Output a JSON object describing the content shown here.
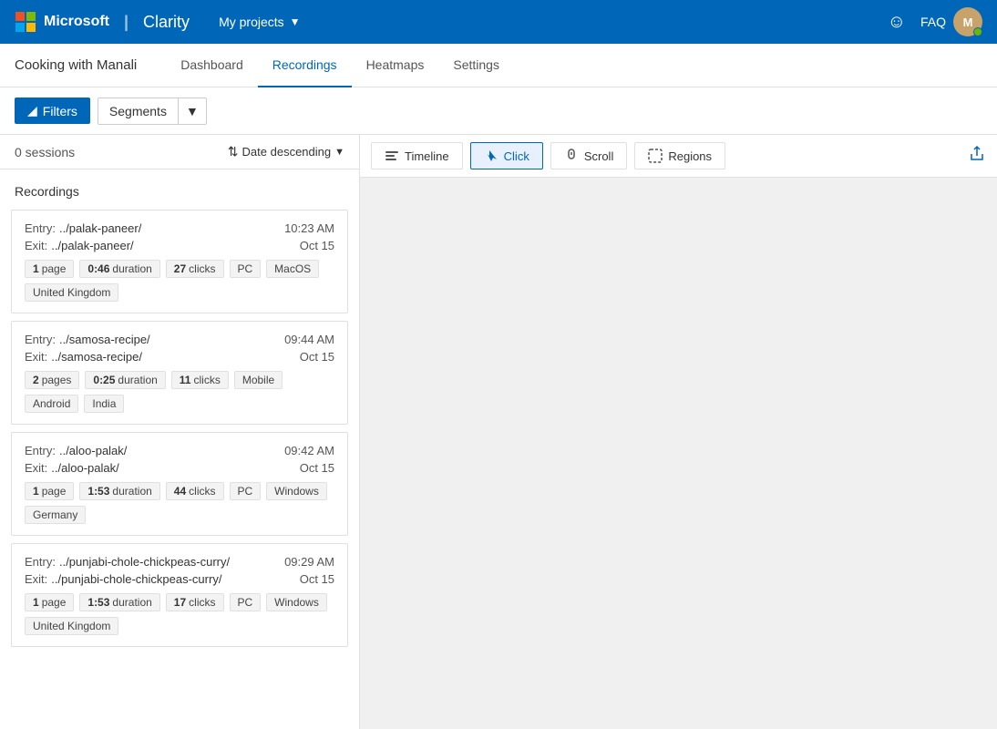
{
  "brand": {
    "ms_label": "Microsoft",
    "divider": "|",
    "clarity_label": "Clarity"
  },
  "topnav": {
    "my_projects": "My projects",
    "faq": "FAQ"
  },
  "subnav": {
    "project_title": "Cooking with Manali",
    "tabs": [
      {
        "label": "Dashboard",
        "active": false
      },
      {
        "label": "Recordings",
        "active": true
      },
      {
        "label": "Heatmaps",
        "active": false
      },
      {
        "label": "Settings",
        "active": false
      }
    ]
  },
  "toolbar": {
    "filter_label": "Filters",
    "segments_label": "Segments"
  },
  "sessions": {
    "count_label": "0 sessions",
    "sort_label": "Date descending"
  },
  "recordings_section": {
    "header": "Recordings",
    "cards": [
      {
        "entry_label": "Entry:",
        "entry_path": "../palak-paneer/",
        "exit_label": "Exit:",
        "exit_path": "../palak-paneer/",
        "time": "10:23 AM",
        "date": "Oct 15",
        "pages_count": "1",
        "pages_label": "page",
        "duration": "0:46",
        "duration_label": "duration",
        "clicks": "27",
        "clicks_label": "clicks",
        "tags": [
          "PC",
          "MacOS",
          "United Kingdom"
        ]
      },
      {
        "entry_label": "Entry:",
        "entry_path": "../samosa-recipe/",
        "exit_label": "Exit:",
        "exit_path": "../samosa-recipe/",
        "time": "09:44 AM",
        "date": "Oct 15",
        "pages_count": "2",
        "pages_label": "pages",
        "duration": "0:25",
        "duration_label": "duration",
        "clicks": "11",
        "clicks_label": "clicks",
        "tags": [
          "Mobile",
          "Android",
          "India"
        ]
      },
      {
        "entry_label": "Entry:",
        "entry_path": "../aloo-palak/",
        "exit_label": "Exit:",
        "exit_path": "../aloo-palak/",
        "time": "09:42 AM",
        "date": "Oct 15",
        "pages_count": "1",
        "pages_label": "page",
        "duration": "1:53",
        "duration_label": "duration",
        "clicks": "44",
        "clicks_label": "clicks",
        "tags": [
          "PC",
          "Windows",
          "Germany"
        ]
      },
      {
        "entry_label": "Entry:",
        "entry_path": "../punjabi-chole-chickpeas-curry/",
        "exit_label": "Exit:",
        "exit_path": "../punjabi-chole-chickpeas-curry/",
        "time": "09:29 AM",
        "date": "Oct 15",
        "pages_count": "1",
        "pages_label": "page",
        "duration": "1:53",
        "duration_label": "duration",
        "clicks": "17",
        "clicks_label": "clicks",
        "tags": [
          "PC",
          "Windows",
          "United Kingdom"
        ]
      }
    ]
  },
  "heatmap_toolbar": {
    "timeline_label": "Timeline",
    "click_label": "Click",
    "scroll_label": "Scroll",
    "regions_label": "Regions"
  }
}
